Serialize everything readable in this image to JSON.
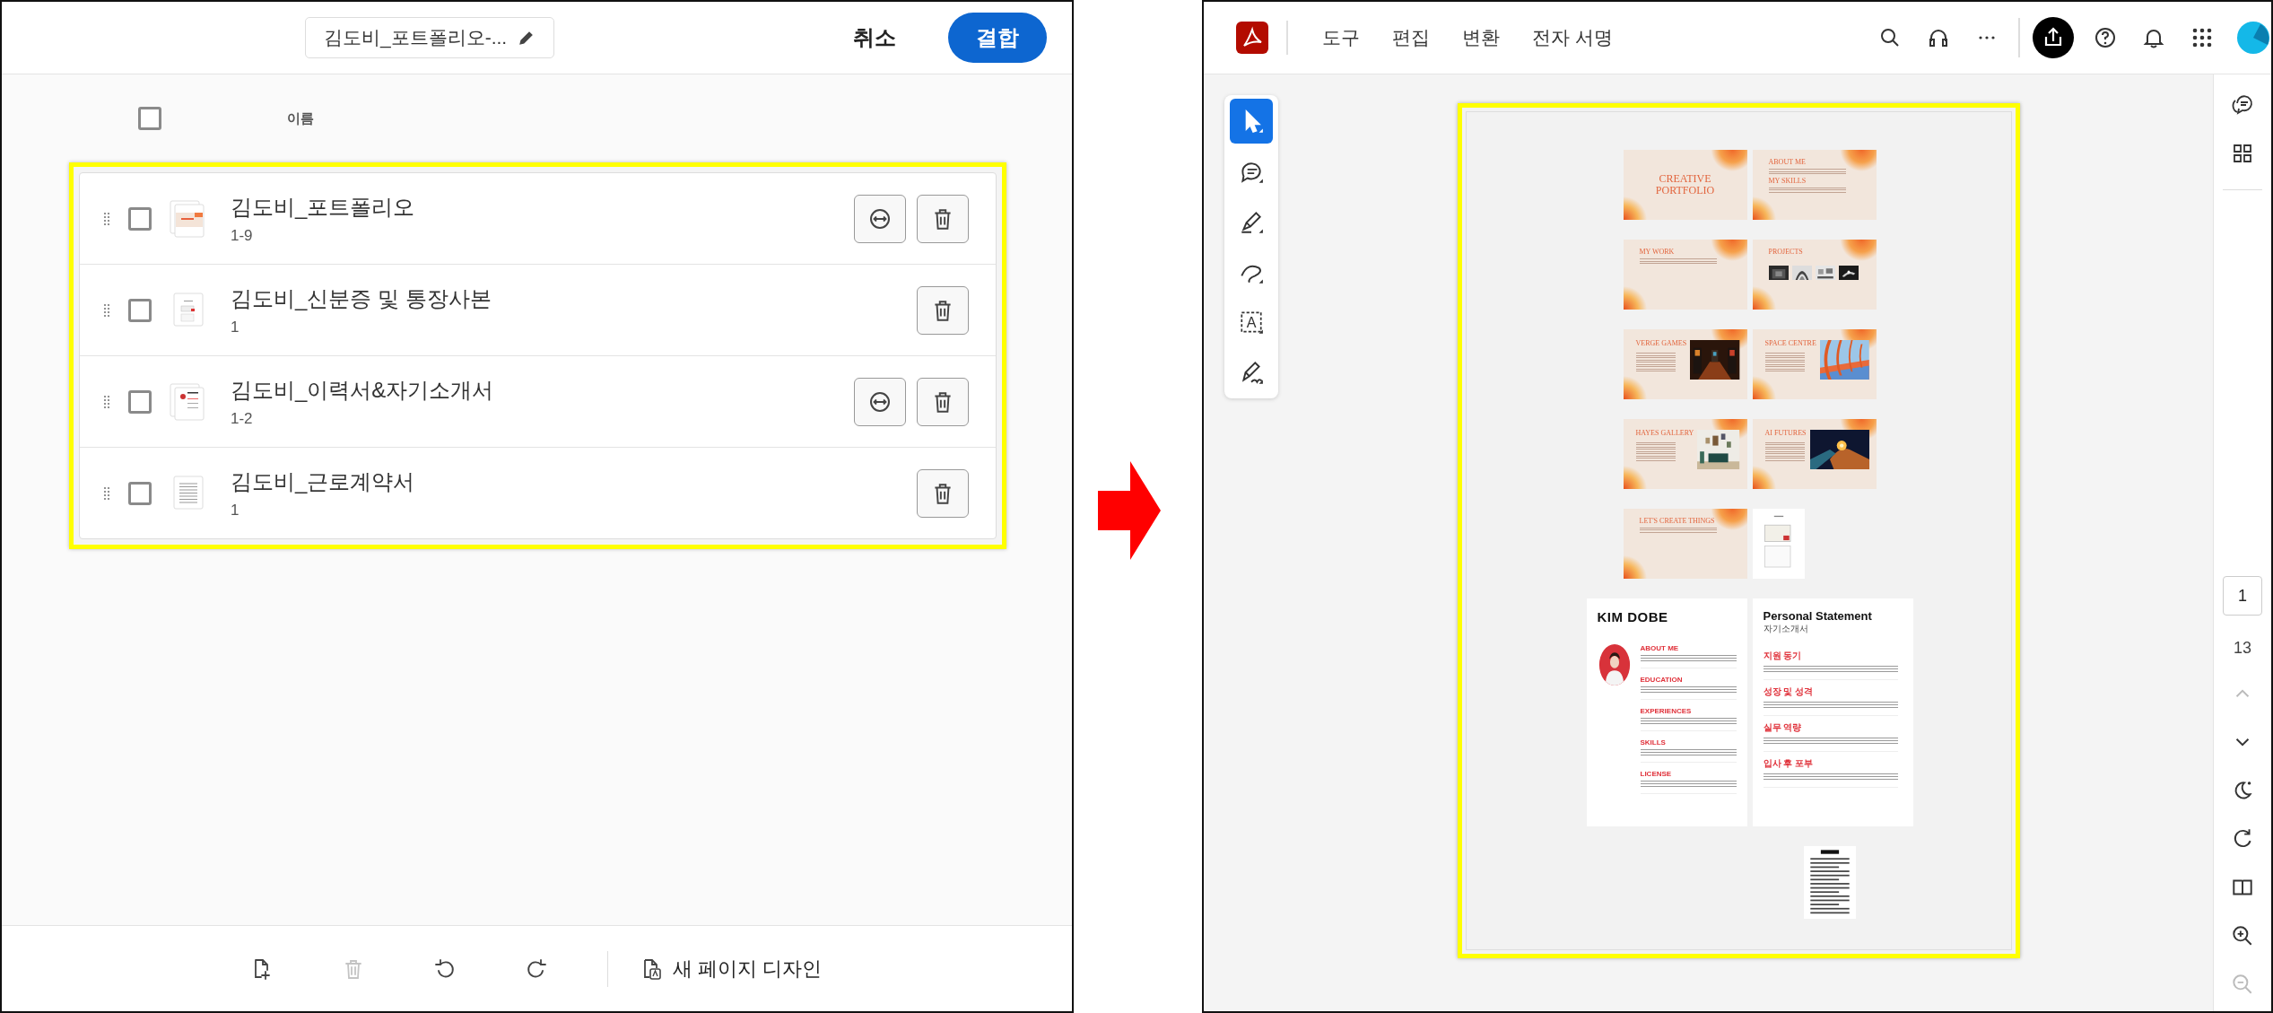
{
  "combine_panel": {
    "file_name": "김도비_포트폴리오-...",
    "cancel": "취소",
    "combine": "결합",
    "select_all": {
      "checked": false
    },
    "column_label": "이름",
    "files": [
      {
        "name": "김도비_포트폴리오",
        "pages": "1-9",
        "checked": false,
        "multi_page": true,
        "kind": "slides"
      },
      {
        "name": "김도비_신분증 및 통장사본",
        "pages": "1",
        "checked": false,
        "multi_page": false,
        "kind": "scan"
      },
      {
        "name": "김도비_이력서&자기소개서",
        "pages": "1-2",
        "checked": false,
        "multi_page": true,
        "kind": "resume"
      },
      {
        "name": "김도비_근로계약서",
        "pages": "1",
        "checked": false,
        "multi_page": false,
        "kind": "contract"
      }
    ],
    "toolbar": [
      {
        "kind": "add",
        "disabled": false
      },
      {
        "kind": "delete",
        "disabled": true
      },
      {
        "kind": "undo",
        "disabled": false
      },
      {
        "kind": "redo",
        "disabled": false
      }
    ],
    "design_button": "새 페이지 디자인"
  },
  "viewer": {
    "menu": [
      "도구",
      "편집",
      "변환",
      "전자 서명"
    ],
    "tools": [
      {
        "kind": "select",
        "selected": true
      },
      {
        "kind": "comment",
        "selected": false
      },
      {
        "kind": "highlight",
        "selected": false
      },
      {
        "kind": "draw",
        "selected": false
      },
      {
        "kind": "text",
        "glyph": "A",
        "selected": false
      },
      {
        "kind": "sign",
        "selected": false
      }
    ],
    "page_number": "1",
    "page_count": "13",
    "rail": [
      {
        "kind": "previous",
        "disabled": true
      },
      {
        "kind": "next",
        "disabled": false
      },
      {
        "kind": "theme",
        "disabled": false
      },
      {
        "kind": "rotate",
        "disabled": false
      },
      {
        "kind": "two_page",
        "disabled": false
      },
      {
        "kind": "zoom_in",
        "disabled": false
      },
      {
        "kind": "zoom_out",
        "disabled": true
      }
    ],
    "page_rows": [
      [
        {
          "kind": "title",
          "headings": [
            "CREATIVE PORTFOLIO"
          ]
        },
        {
          "kind": "about",
          "headings": [
            "ABOUT ME",
            "MY SKILLS"
          ]
        }
      ],
      [
        {
          "kind": "text",
          "headings": [
            "MY WORK"
          ]
        },
        {
          "kind": "gallery",
          "headings": [
            "PROJECTS"
          ]
        }
      ],
      [
        {
          "headings": [
            "VERGE GAMES"
          ]
        },
        {
          "headings": [
            "SPACE CENTRE"
          ]
        }
      ],
      [
        {
          "headings": [
            "HAYES GALLERY"
          ]
        },
        {
          "headings": [
            "AI FUTURES"
          ]
        }
      ],
      [
        {
          "kind": "closing",
          "headings": [
            "LET'S CREATE THINGS"
          ]
        },
        {
          "kind": "scan"
        }
      ],
      [
        {
          "kind": "resume",
          "title": "KIM DOBE",
          "headings": [
            "ABOUT ME",
            "EDUCATION",
            "EXPERIENCES",
            "SKILLS",
            "LICENSE"
          ]
        },
        {
          "kind": "statement",
          "title": "Personal Statement",
          "subtitle": "자기소개서",
          "headings": [
            "지원 동기",
            "성장 및 성격",
            "실무 역량",
            "입사 후 포부"
          ]
        }
      ],
      [
        {
          "kind": "contract"
        }
      ]
    ]
  }
}
